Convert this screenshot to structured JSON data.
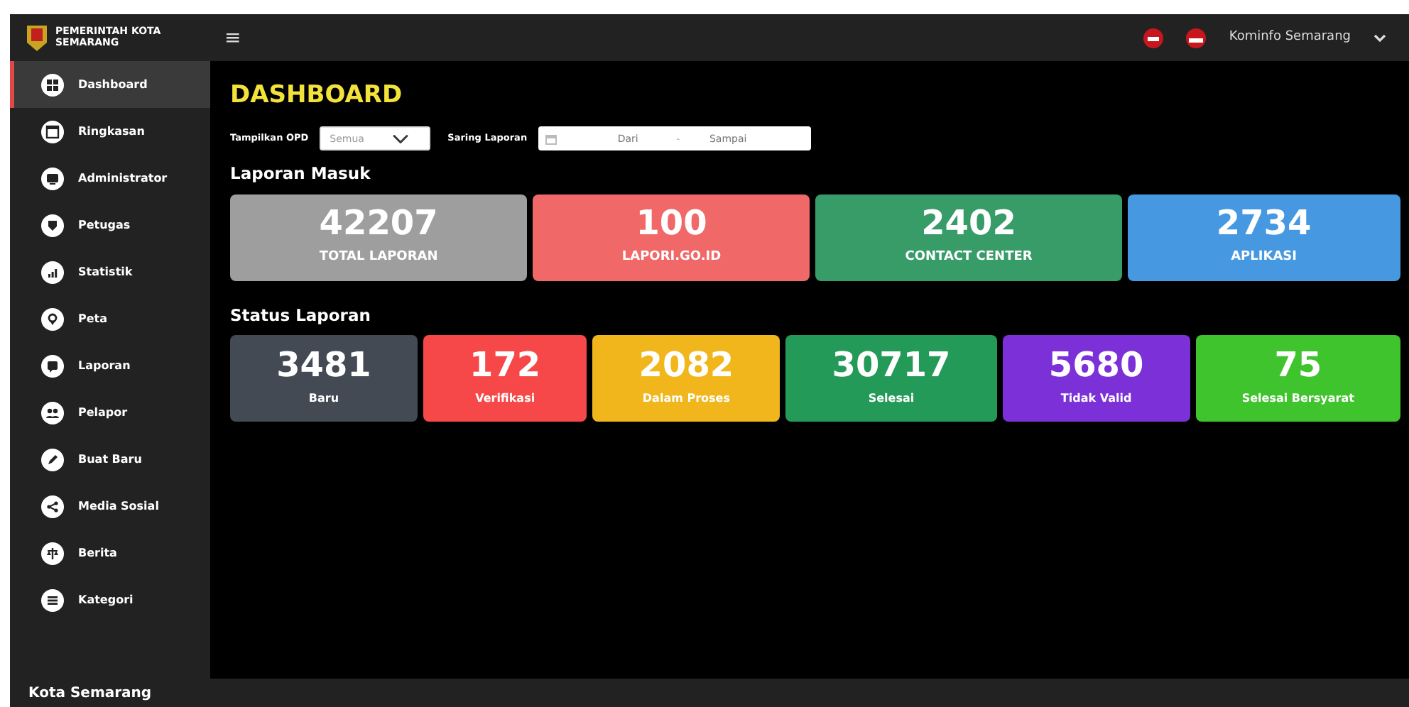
{
  "brand": {
    "title": "PEMERINTAH KOTA SEMARANG"
  },
  "header": {
    "menu_toggle": "≡",
    "user": "Kominfo Semarang"
  },
  "sidebar": {
    "items": [
      {
        "label": "Dashboard",
        "selected": true
      },
      {
        "label": "Ringkasan",
        "selected": false
      },
      {
        "label": "Administrator",
        "selected": false
      },
      {
        "label": "Petugas",
        "selected": false
      },
      {
        "label": "Statistik",
        "selected": false
      },
      {
        "label": "Peta",
        "selected": false
      },
      {
        "label": "Laporan",
        "selected": false
      },
      {
        "label": "Pelapor",
        "selected": false
      },
      {
        "label": "Buat Baru",
        "selected": false
      },
      {
        "label": "Media Sosial",
        "selected": false
      },
      {
        "label": "Berita",
        "selected": false
      },
      {
        "label": "Kategori",
        "selected": false
      }
    ]
  },
  "page_title": "DASHBOARD",
  "filters": {
    "opd_label": "Tampilkan OPD",
    "opd_value": "Semua",
    "range_label": "Saring Laporan",
    "from_placeholder": "Dari",
    "separator": "-",
    "to_placeholder": "Sampai"
  },
  "incoming": {
    "heading": "Laporan Masuk",
    "cards": [
      {
        "value": "42207",
        "label": "TOTAL LAPORAN",
        "color": "#9e9e9e"
      },
      {
        "value": "100",
        "label": "LAPORI.GO.ID",
        "color": "#f06868"
      },
      {
        "value": "2402",
        "label": "CONTACT CENTER",
        "color": "#389c68"
      },
      {
        "value": "2734",
        "label": "APLIKASI",
        "color": "#4698e0"
      }
    ]
  },
  "status": {
    "heading": "Status Laporan",
    "cards": [
      {
        "value": "3481",
        "label": "Baru",
        "color": "#434a54"
      },
      {
        "value": "172",
        "label": "Verifikasi",
        "color": "#f64848"
      },
      {
        "value": "2082",
        "label": "Dalam Proses",
        "color": "#f0b61c"
      },
      {
        "value": "30717",
        "label": "Selesai",
        "color": "#249a58"
      },
      {
        "value": "5680",
        "label": "Tidak Valid",
        "color": "#7c30d8"
      },
      {
        "value": "75",
        "label": "Selesai Bersyarat",
        "color": "#40c42e"
      }
    ]
  },
  "footer": {
    "text": "Kota Semarang"
  }
}
